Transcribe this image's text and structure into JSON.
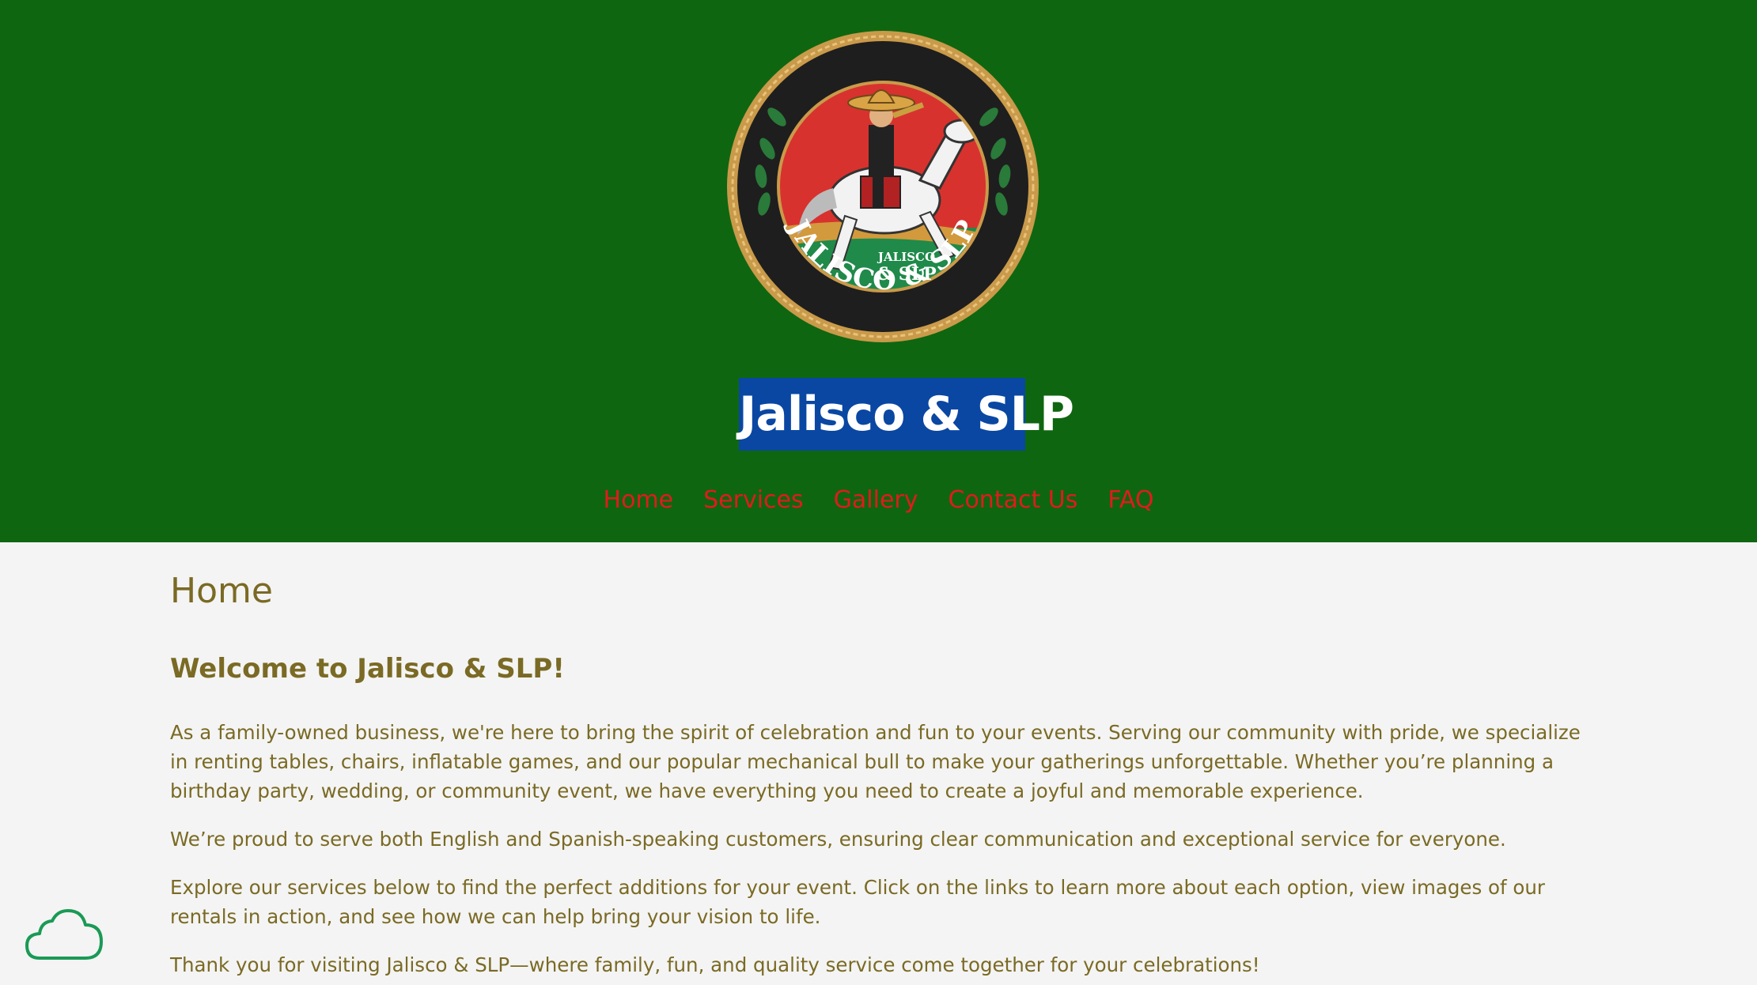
{
  "header": {
    "logo": {
      "icon": "jalisco-slp-logo",
      "text_top": "JALISCO",
      "text_mid": "& SLP",
      "text_ring": "JALISCO & SLP"
    },
    "site_title": "Jalisco & SLP",
    "background_color": "#0f6610",
    "title_highlight_color": "#0a47a3"
  },
  "nav": {
    "items": [
      {
        "label": "Home"
      },
      {
        "label": "Services"
      },
      {
        "label": "Gallery"
      },
      {
        "label": "Contact Us"
      },
      {
        "label": "FAQ"
      }
    ],
    "color": "#e01b1b"
  },
  "main": {
    "page_heading": "Home",
    "welcome_heading": "Welcome to Jalisco & SLP!",
    "paragraphs": [
      "As a family-owned business, we're here to bring the spirit of celebration and fun to your events. Serving our community with pride, we specialize in renting tables, chairs, inflatable games, and our popular mechanical bull to make your gatherings unforgettable. Whether you’re planning a birthday party, wedding, or community event, we have everything you need to create a joyful and memorable experience.",
      "We’re proud to serve both English and Spanish-speaking customers, ensuring clear communication and exceptional service for everyone.",
      "Explore our services below to find the perfect additions for your event. Click on the links to learn more about each option, view images of our rentals in action, and see how we can help bring your vision to life.",
      "Thank you for visiting Jalisco & SLP—where family, fun, and quality service come together for your celebrations!"
    ],
    "text_color": "#7a6a24"
  },
  "floating": {
    "icon": "cloud-icon",
    "color": "#1a9a55"
  }
}
